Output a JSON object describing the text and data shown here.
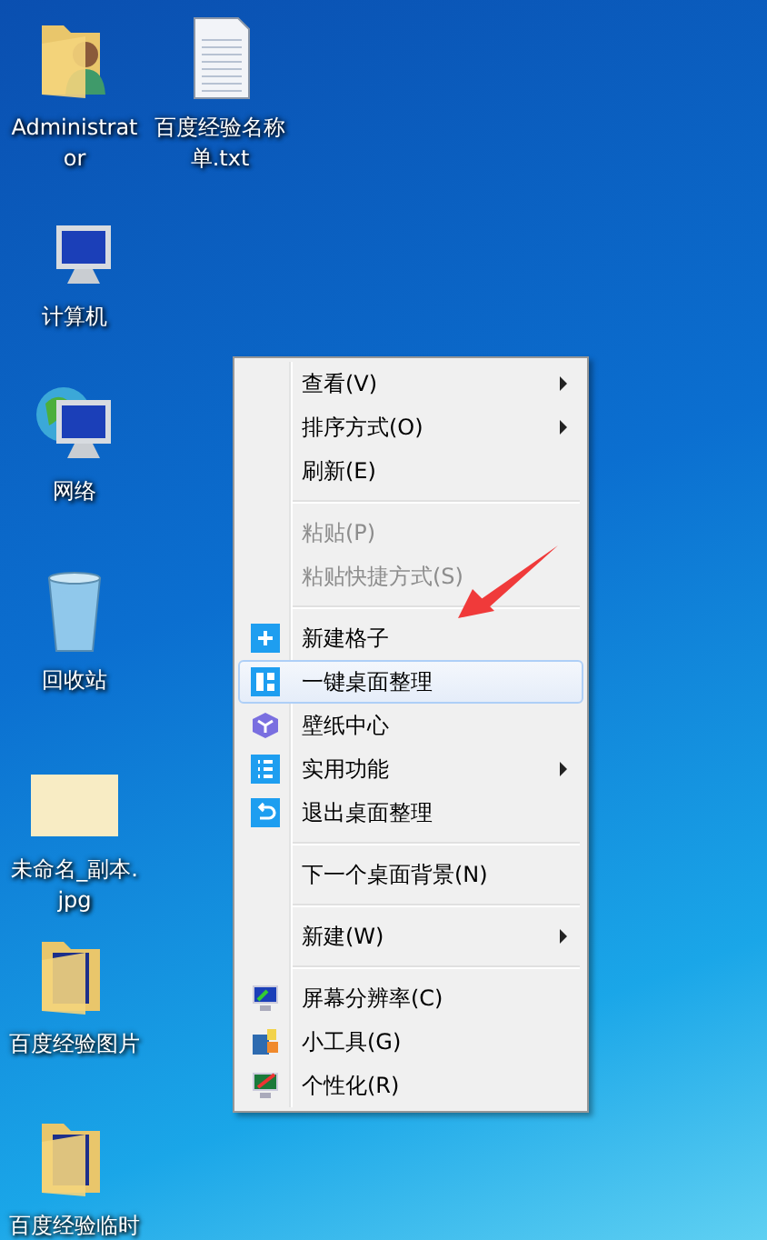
{
  "desktop_icons": [
    {
      "label": "Administrator",
      "kind": "user-folder"
    },
    {
      "label": "百度经验名称单.txt",
      "kind": "text-file"
    },
    {
      "label": "计算机",
      "kind": "computer"
    },
    {
      "label": "网络",
      "kind": "network"
    },
    {
      "label": "回收站",
      "kind": "recycle-bin"
    },
    {
      "label": "未命名_副本.jpg",
      "kind": "image"
    },
    {
      "label": "百度经验图片",
      "kind": "folder"
    },
    {
      "label": "百度经验临时",
      "kind": "folder"
    }
  ],
  "context_menu": {
    "items": [
      {
        "kind": "item",
        "label": "查看(V)",
        "submenu": true,
        "disabled": false,
        "selected": false
      },
      {
        "kind": "item",
        "label": "排序方式(O)",
        "submenu": true,
        "disabled": false,
        "selected": false
      },
      {
        "kind": "item",
        "label": "刷新(E)",
        "submenu": false,
        "disabled": false,
        "selected": false
      },
      {
        "kind": "separator"
      },
      {
        "kind": "item",
        "label": "粘贴(P)",
        "submenu": false,
        "disabled": true,
        "selected": false
      },
      {
        "kind": "item",
        "label": "粘贴快捷方式(S)",
        "submenu": false,
        "disabled": true,
        "selected": false
      },
      {
        "kind": "separator"
      },
      {
        "kind": "item",
        "label": "新建格子",
        "submenu": false,
        "disabled": false,
        "selected": false
      },
      {
        "kind": "item",
        "label": "一键桌面整理",
        "submenu": false,
        "disabled": false,
        "selected": true
      },
      {
        "kind": "item",
        "label": "壁纸中心",
        "submenu": false,
        "disabled": false,
        "selected": false
      },
      {
        "kind": "item",
        "label": "实用功能",
        "submenu": true,
        "disabled": false,
        "selected": false
      },
      {
        "kind": "item",
        "label": "退出桌面整理",
        "submenu": false,
        "disabled": false,
        "selected": false
      },
      {
        "kind": "separator"
      },
      {
        "kind": "item",
        "label": "下一个桌面背景(N)",
        "submenu": false,
        "disabled": false,
        "selected": false
      },
      {
        "kind": "separator"
      },
      {
        "kind": "item",
        "label": "新建(W)",
        "submenu": true,
        "disabled": false,
        "selected": false
      },
      {
        "kind": "separator"
      },
      {
        "kind": "item",
        "label": "屏幕分辨率(C)",
        "submenu": false,
        "disabled": false,
        "selected": false
      },
      {
        "kind": "item",
        "label": "小工具(G)",
        "submenu": false,
        "disabled": false,
        "selected": false
      },
      {
        "kind": "item",
        "label": "个性化(R)",
        "submenu": false,
        "disabled": false,
        "selected": false
      }
    ]
  }
}
